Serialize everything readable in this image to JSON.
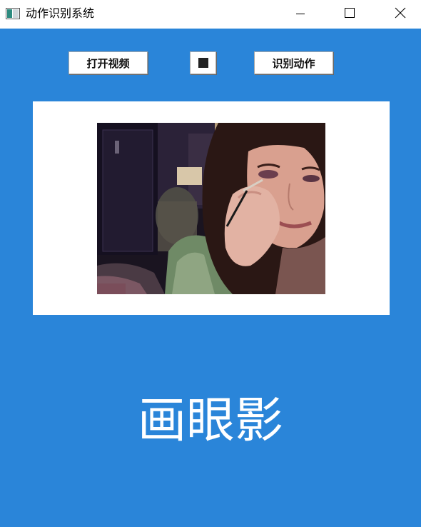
{
  "window": {
    "title": "动作识别系统"
  },
  "toolbar": {
    "open_video_label": "打开视频",
    "stop_icon": "stop-square-icon",
    "recognize_label": "识别动作"
  },
  "result": {
    "action_label": "画眼影"
  },
  "colors": {
    "background_blue": "#2a85d9",
    "panel_white": "#ffffff"
  }
}
